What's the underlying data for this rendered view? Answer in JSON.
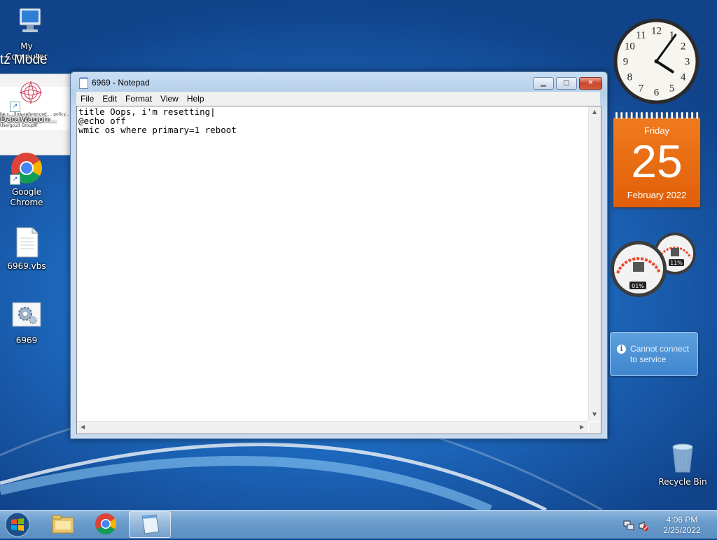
{
  "desktop": {
    "mode_text": "tz Mode",
    "icons": [
      {
        "label": "My Computer",
        "icon": "computer-icon"
      },
      {
        "label": "DataWagon...",
        "icon": "datawagon-icon"
      },
      {
        "label": "Google Chrome",
        "icon": "chrome-icon"
      },
      {
        "label": "6969.vbs",
        "icon": "script-file-icon"
      },
      {
        "label": "6969",
        "icon": "settings-gear-icon"
      },
      {
        "label": "Recycle Bin",
        "icon": "recycle-bin-icon"
      }
    ],
    "background_window_text": "he s... llow-referenced ... policy... tact your administra... d Usergoud Groups."
  },
  "notepad": {
    "title": "6969 - Notepad",
    "menu": [
      "File",
      "Edit",
      "Format",
      "View",
      "Help"
    ],
    "content_lines": [
      "title Oops, i'm resetting",
      "@echo off",
      "wmic os where primary=1 reboot"
    ],
    "buttons": {
      "minimize": "▁",
      "maximize": "▢",
      "close": "✕"
    }
  },
  "gadgets": {
    "clock": {
      "time": "4:06",
      "numbers": [
        "12",
        "1",
        "2",
        "3",
        "4",
        "5",
        "6",
        "7",
        "8",
        "9",
        "10",
        "11"
      ]
    },
    "calendar": {
      "day": "Friday",
      "date": "25",
      "month_year": "February 2022"
    },
    "cpu_meter": {
      "cpu": "01%",
      "memory": "11%"
    },
    "weather": {
      "message": "Cannot connect to service"
    }
  },
  "taskbar": {
    "time": "4:06 PM",
    "date": "2/25/2022",
    "apps": [
      "windows-explorer-icon",
      "chrome-icon",
      "notepad-icon"
    ]
  },
  "colors": {
    "accent": "#1f6fc6",
    "calendar": "#e86a10"
  }
}
